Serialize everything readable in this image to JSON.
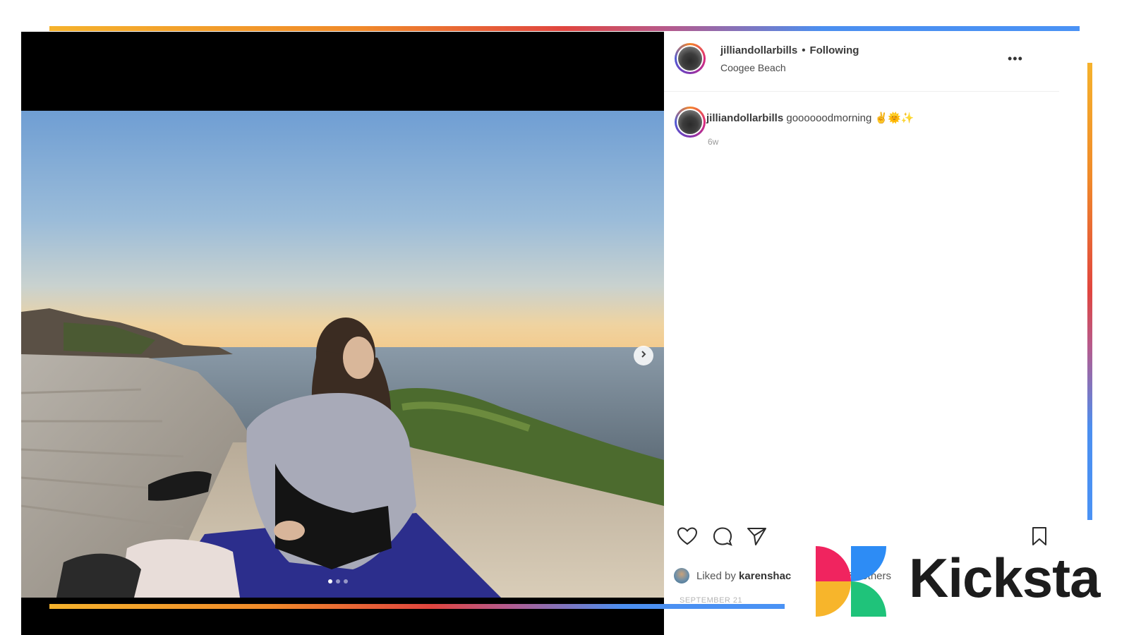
{
  "post": {
    "username": "jilliandollarbills",
    "separator": "•",
    "follow_status": "Following",
    "location": "Coogee Beach",
    "caption_text": "goooooodmorning ✌️🌞✨",
    "time_ago": "6w",
    "liked_by_prefix": "Liked by",
    "liked_by_user": "karenshac",
    "liked_by_suffix": "70 others",
    "date": "SEPTEMBER 21",
    "carousel": {
      "total": 3,
      "active_index": 0
    }
  },
  "icons": {
    "more": "more-options-icon",
    "like": "heart-icon",
    "comment": "comment-icon",
    "share": "send-icon",
    "save": "bookmark-icon",
    "next": "chevron-right-icon"
  },
  "brand": {
    "name": "Kicksta",
    "colors": {
      "pink": "#f0245f",
      "blue": "#2d8cf5",
      "green": "#1fc37a",
      "yellow": "#f7b52b",
      "gradient_orange": "#f08a2a",
      "gradient_red": "#e0453f",
      "gradient_blue": "#4a92f5"
    }
  }
}
